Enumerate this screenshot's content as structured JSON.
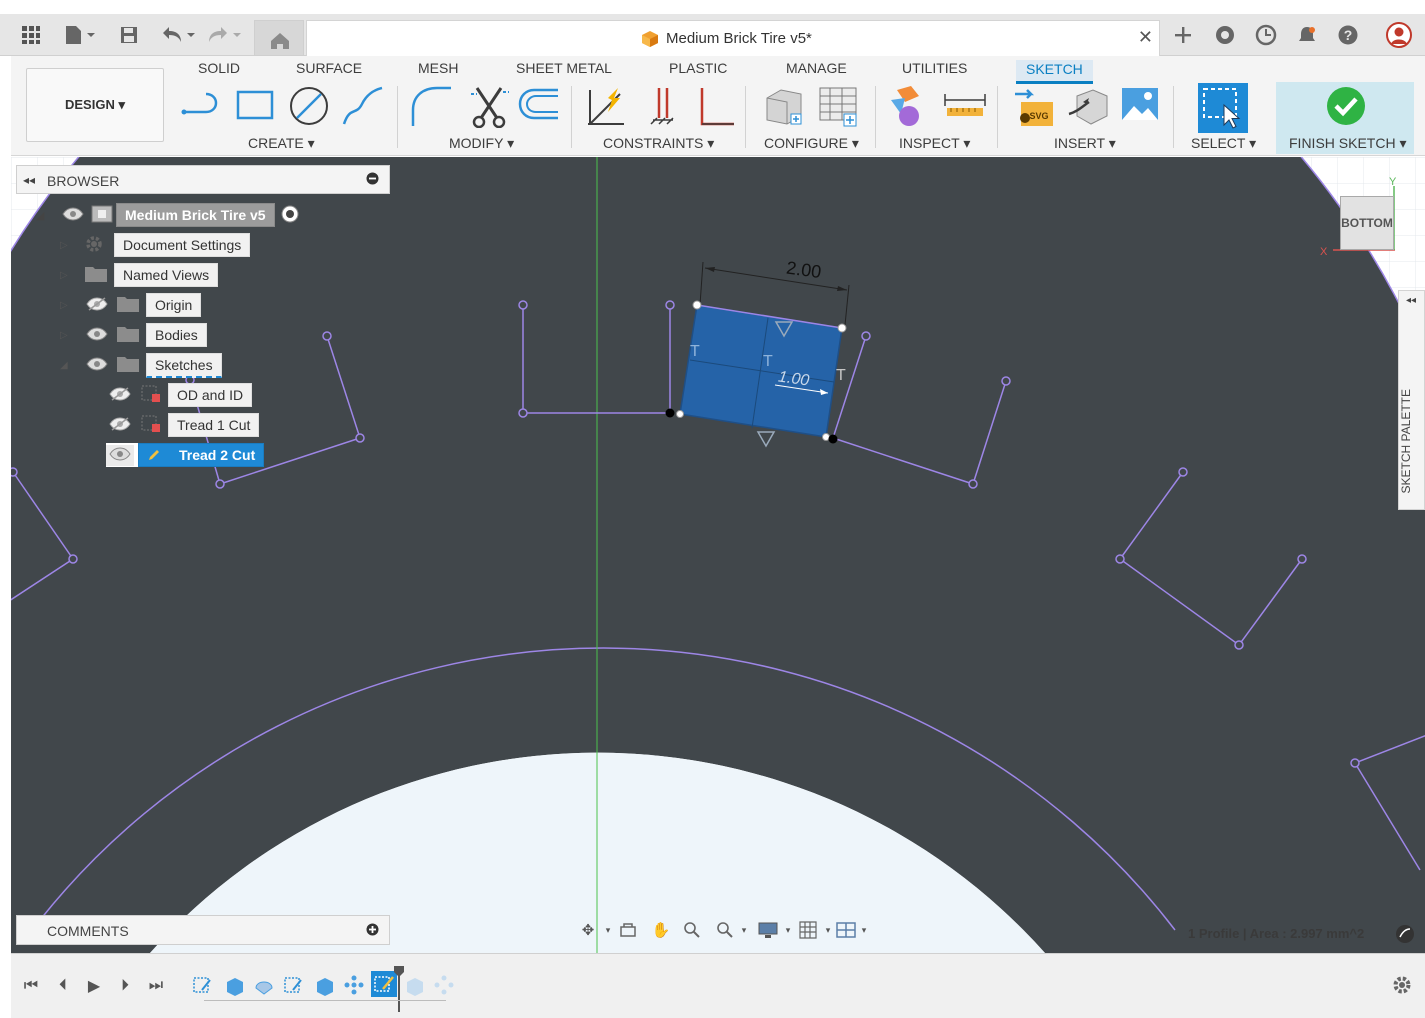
{
  "app": {
    "document_title": "Medium Brick Tire v5*"
  },
  "ribbon": {
    "workspace": "DESIGN ▾",
    "tabs": [
      "SOLID",
      "SURFACE",
      "MESH",
      "SHEET METAL",
      "PLASTIC",
      "MANAGE",
      "UTILITIES",
      "SKETCH"
    ],
    "active_tab": "SKETCH",
    "groups": {
      "create": "CREATE ▾",
      "modify": "MODIFY ▾",
      "constraints": "CONSTRAINTS ▾",
      "configure": "CONFIGURE ▾",
      "inspect": "INSPECT ▾",
      "insert": "INSERT ▾",
      "select": "SELECT ▾",
      "finish": "FINISH SKETCH ▾"
    }
  },
  "browser": {
    "title": "BROWSER",
    "root": "Medium Brick Tire v5",
    "items": [
      {
        "label": "Document Settings"
      },
      {
        "label": "Named Views"
      },
      {
        "label": "Origin"
      },
      {
        "label": "Bodies"
      },
      {
        "label": "Sketches"
      }
    ],
    "sketches": [
      {
        "label": "OD and ID"
      },
      {
        "label": "Tread 1 Cut"
      },
      {
        "label": "Tread 2 Cut"
      }
    ]
  },
  "canvas": {
    "dimension_width": "2.00",
    "dimension_height": "1.00",
    "viewcube_face": "BOTTOM",
    "axis_y": "Y",
    "axis_x": "X",
    "status": "1 Profile | Area : 2.997 mm^2",
    "sketch_palette": "SKETCH PALETTE"
  },
  "comments": {
    "title": "COMMENTS"
  },
  "colors": {
    "accent": "#0a7fc2",
    "tire": "#41474b",
    "sketch_line": "#9d86e6",
    "selected_profile": "#2563a8"
  }
}
